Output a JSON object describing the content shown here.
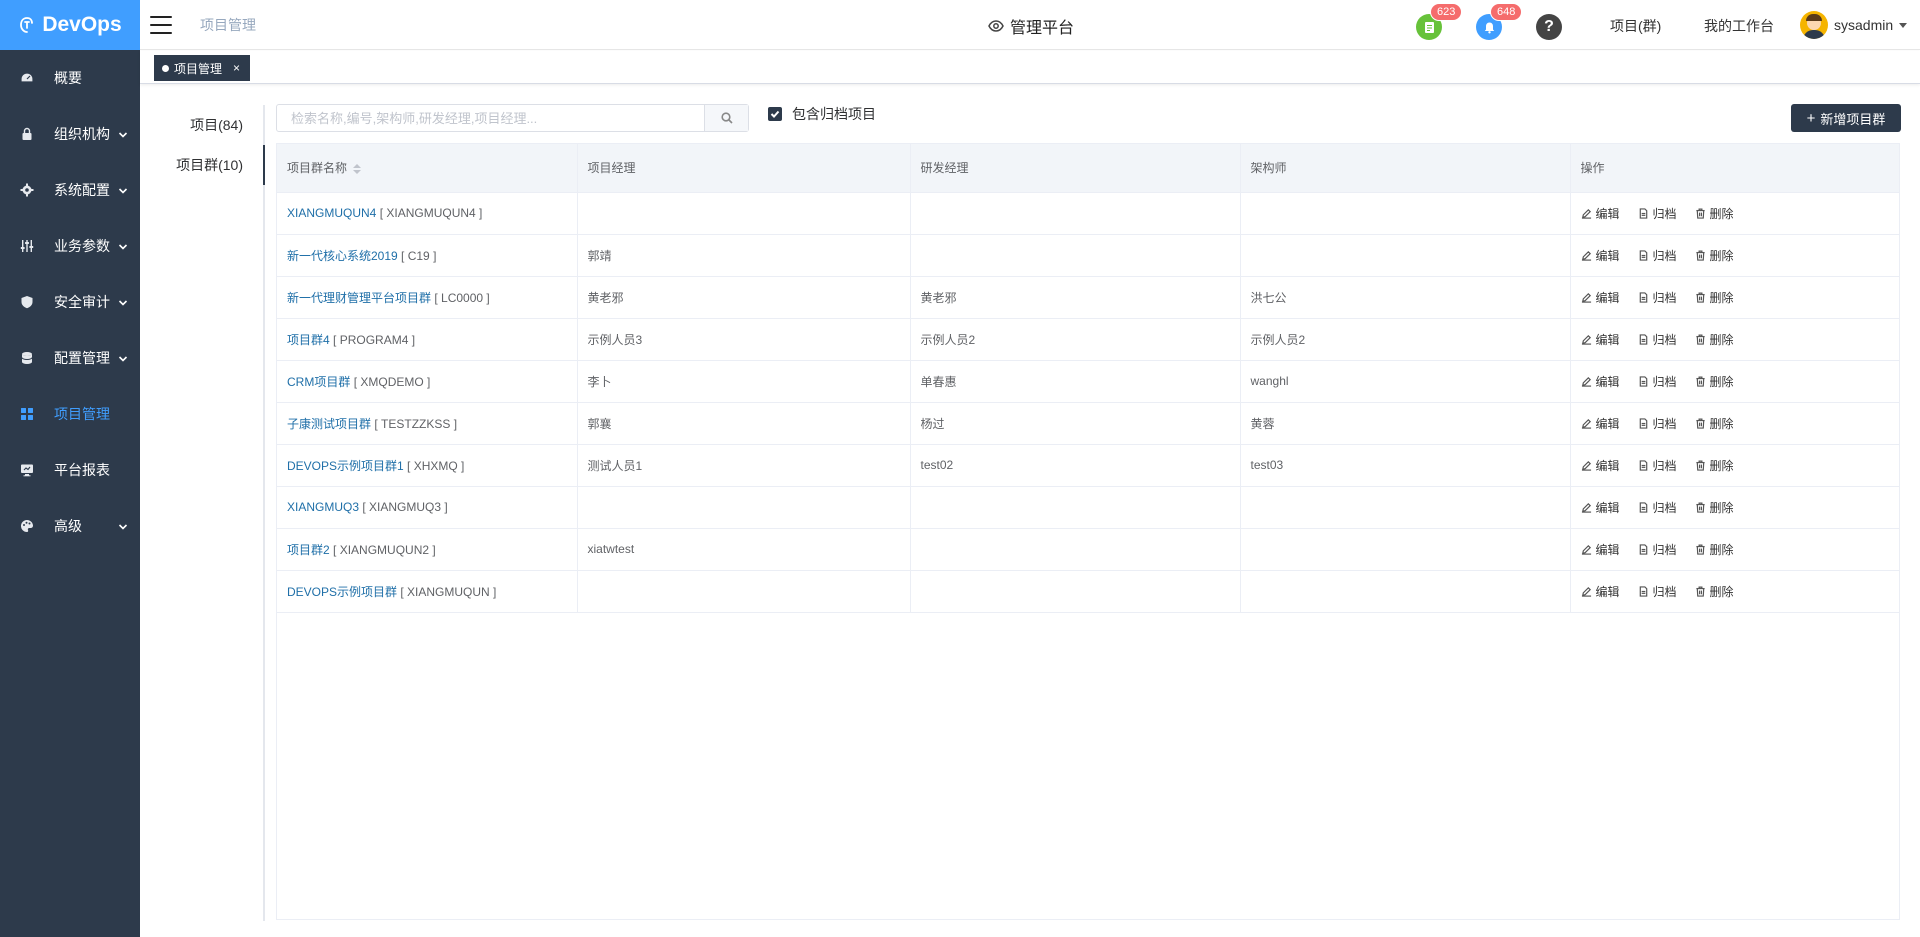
{
  "app": {
    "logo": "DevOps"
  },
  "sidebar": {
    "items": [
      {
        "label": "概要",
        "icon": "dashboard-icon",
        "chevron": false,
        "active": false
      },
      {
        "label": "组织机构",
        "icon": "lock-icon",
        "chevron": true,
        "active": false
      },
      {
        "label": "系统配置",
        "icon": "gear-icon",
        "chevron": true,
        "active": false
      },
      {
        "label": "业务参数",
        "icon": "sliders-icon",
        "chevron": true,
        "active": false
      },
      {
        "label": "安全审计",
        "icon": "shield-icon",
        "chevron": true,
        "active": false
      },
      {
        "label": "配置管理",
        "icon": "database-icon",
        "chevron": true,
        "active": false
      },
      {
        "label": "项目管理",
        "icon": "grid-icon",
        "chevron": false,
        "active": true
      },
      {
        "label": "平台报表",
        "icon": "monitor-icon",
        "chevron": false,
        "active": false
      },
      {
        "label": "高级",
        "icon": "palette-icon",
        "chevron": true,
        "active": false
      }
    ]
  },
  "header": {
    "breadcrumb": "项目管理",
    "center_title": "管理平台",
    "todo_count": "623",
    "notify_count": "648",
    "link_project_group": "项目(群)",
    "link_workbench": "我的工作台",
    "username": "sysadmin"
  },
  "tags": {
    "active_tag": "项目管理",
    "close": "×"
  },
  "tabs": {
    "projects": "项目(84)",
    "groups": "项目群(10)"
  },
  "toolbar": {
    "search_placeholder": "检索名称,编号,架构师,研发经理,项目经理...",
    "include_archived": "包含归档项目",
    "add_button": "新增项目群"
  },
  "table": {
    "headers": [
      "项目群名称",
      "项目经理",
      "研发经理",
      "架构师",
      "操作"
    ],
    "actions": {
      "edit": "编辑",
      "archive": "归档",
      "delete": "删除"
    },
    "rows": [
      {
        "name": "XIANGMUQUN4",
        "code": "[ XIANGMUQUN4 ]",
        "pm": "",
        "rd": "",
        "arch": ""
      },
      {
        "name": "新一代核心系统2019",
        "code": "[ C19 ]",
        "pm": "郭靖",
        "rd": "",
        "arch": ""
      },
      {
        "name": "新一代理财管理平台项目群",
        "code": "[ LC0000 ]",
        "pm": "黄老邪",
        "rd": "黄老邪",
        "arch": "洪七公"
      },
      {
        "name": "项目群4",
        "code": "[ PROGRAM4 ]",
        "pm": "示例人员3",
        "rd": "示例人员2",
        "arch": "示例人员2"
      },
      {
        "name": "CRM项目群",
        "code": "[ XMQDEMO ]",
        "pm": "李卜",
        "rd": "单春惠",
        "arch": "wanghl"
      },
      {
        "name": "子康测试项目群",
        "code": "[ TESTZZKSS ]",
        "pm": "郭襄",
        "rd": "杨过",
        "arch": "黄蓉"
      },
      {
        "name": "DEVOPS示例项目群1",
        "code": "[ XHXMQ ]",
        "pm": "测试人员1",
        "rd": "test02",
        "arch": "test03"
      },
      {
        "name": "XIANGMUQ3",
        "code": "[ XIANGMUQ3 ]",
        "pm": "",
        "rd": "",
        "arch": ""
      },
      {
        "name": "项目群2",
        "code": "[ XIANGMUQUN2 ]",
        "pm": "xiatwtest",
        "rd": "",
        "arch": ""
      },
      {
        "name": "DEVOPS示例项目群",
        "code": "[ XIANGMUQUN ]",
        "pm": "",
        "rd": "",
        "arch": ""
      }
    ]
  },
  "colors": {
    "sidebar_bg": "#2d3a4b",
    "logo_bg": "#409eff",
    "active": "#409eff",
    "link": "#1f6fa8",
    "badge": "#f56c6c"
  }
}
